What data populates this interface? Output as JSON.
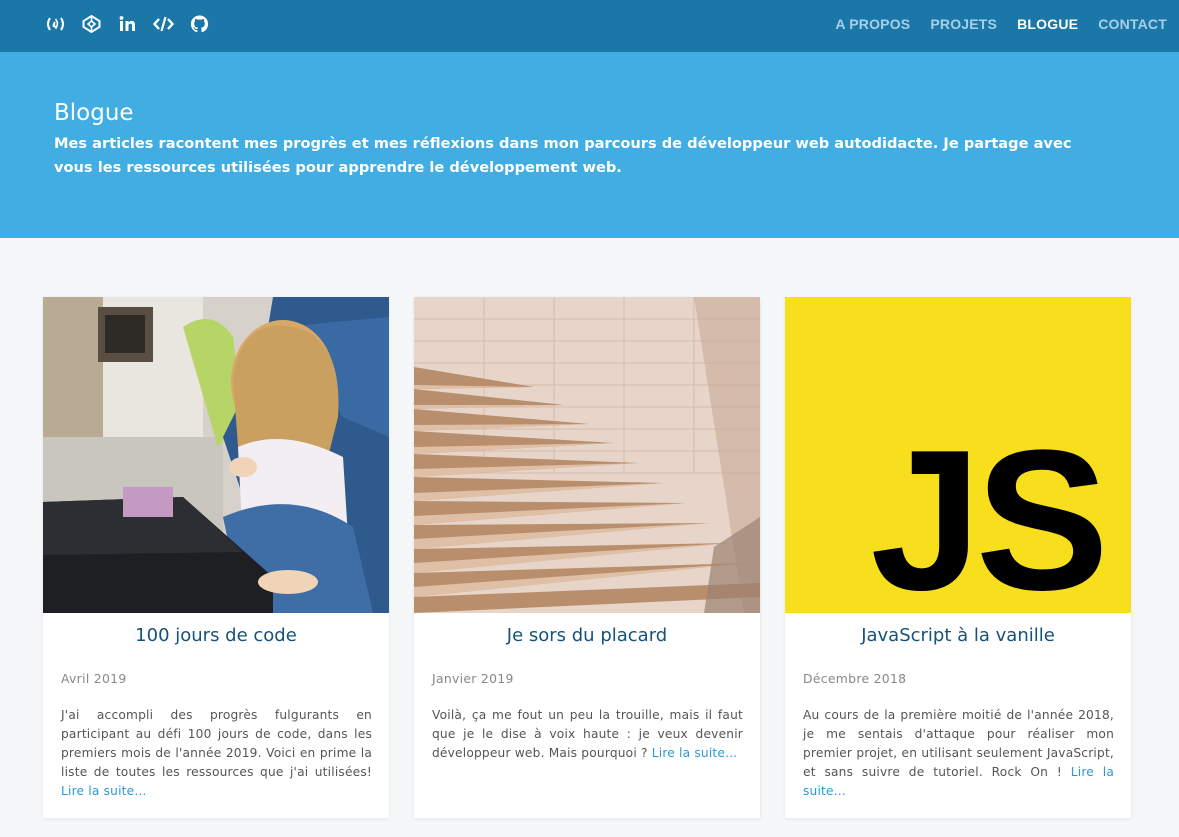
{
  "header": {
    "social_icons": [
      "freecodecamp-icon",
      "codepen-icon",
      "linkedin-icon",
      "code-icon",
      "github-icon"
    ],
    "nav": [
      {
        "label": "A PROPOS",
        "active": false
      },
      {
        "label": "PROJETS",
        "active": false
      },
      {
        "label": "BLOGUE",
        "active": true
      },
      {
        "label": "CONTACT",
        "active": false
      }
    ]
  },
  "hero": {
    "title": "Blogue",
    "text": "Mes articles racontent mes progrès et mes réflexions dans mon parcours de développeur web autodidacte. Je partage avec vous les ressources utilisées pour apprendre le développement web."
  },
  "cards": [
    {
      "title": "100 jours de code",
      "date": "Avril 2019",
      "excerpt": "J'ai accompli des progrès fulgurants en participant au défi 100 jours de code, dans les premiers mois de l'année 2019. Voici en prime la liste de toutes les ressources que j'ai utilisées!",
      "more": "Lire la suite..."
    },
    {
      "title": "Je sors du placard",
      "date": "Janvier 2019",
      "excerpt": "Voilà, ça me fout un peu la trouille, mais il faut que je le dise à voix haute : je veux devenir développeur web. Mais pourquoi ?",
      "more": "Lire la suite..."
    },
    {
      "title": "JavaScript à la vanille",
      "date": "Décembre 2018",
      "excerpt": "Au cours de la première moitié de l'année 2018, je me sentais d'attaque pour réaliser mon premier projet, en utilisant seulement JavaScript, et sans suivre de tutoriel. Rock On !",
      "more": "Lire la suite...",
      "logo_text": "JS"
    }
  ],
  "colors": {
    "topbar": "#1b77a8",
    "hero": "#42ade3",
    "card_title": "#17527a",
    "link": "#2a9ad6",
    "js_yellow": "#f7df1e"
  }
}
